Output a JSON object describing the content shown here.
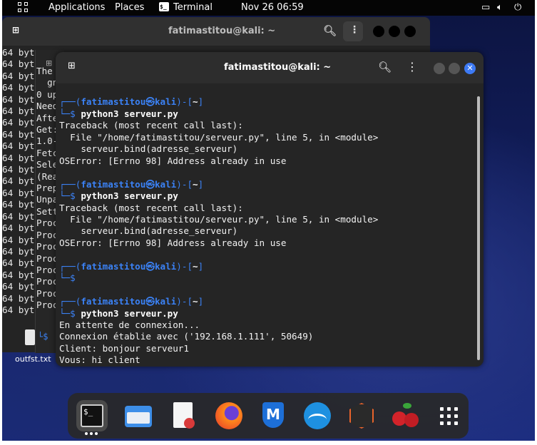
{
  "topbar": {
    "applications": "Applications",
    "places": "Places",
    "terminal": "Terminal",
    "clock": "Nov 26 06:59"
  },
  "bg_terminal": {
    "title": "fatimastitou@kali: ~",
    "left_lines": [
      "64 byt",
      "64 byt",
      "64 byt",
      "64 byt",
      "64 byt",
      "64 byt",
      "64 byt",
      "64 byt",
      "64 byt",
      "64 byt",
      "64 byt",
      "64 byt",
      "64 byt",
      "64 byt",
      "64 byt",
      "64 byt",
      "64 byt",
      "64 byt",
      "64 byt",
      "64 byt",
      "64 byt",
      "64 byt",
      "64 byt"
    ],
    "mid_lines": [
      "The",
      "  gn",
      "0 up",
      "Need",
      "Afte",
      "Get:",
      "1.0-",
      "Fetc",
      "Sele",
      "(Rea",
      "Prep",
      "Unpa",
      "Sett",
      "Proc",
      "Proc",
      "Proc",
      "Proc",
      "Proc",
      "Proc",
      "Proc",
      "Proc"
    ]
  },
  "main_terminal": {
    "title": "fatimastitou@kali: ~",
    "prompt_user": "fatimastitou",
    "prompt_at": "㉿",
    "prompt_host": "kali",
    "prompt_dir": "~",
    "cmd": "python3 serveur.py",
    "tb1": "Traceback (most recent call last):",
    "tb2": "  File \"/home/fatimastitou/serveur.py\", line 5, in <module>",
    "tb3": "    serveur.bind(adresse_serveur)",
    "tb4": "OSError: [Errno 98] Address already in use",
    "out1": "En attente de connexion...",
    "out2": "Connexion établie avec ('192.168.1.111', 50649)",
    "out3": "Client: bonjour serveur1",
    "out4": "Vous: hi client"
  },
  "desktop_file": "outfst.txt",
  "dock": {
    "items": [
      "terminal-icon",
      "files-icon",
      "text-editor-icon",
      "firefox-icon",
      "metasploit-icon",
      "wireshark-icon",
      "burpsuite-icon",
      "cherrytree-icon",
      "app-grid-icon"
    ]
  },
  "colors": {
    "accent": "#3b82f6",
    "close_button": "#3d7af5",
    "terminal_bg": "#252525"
  }
}
